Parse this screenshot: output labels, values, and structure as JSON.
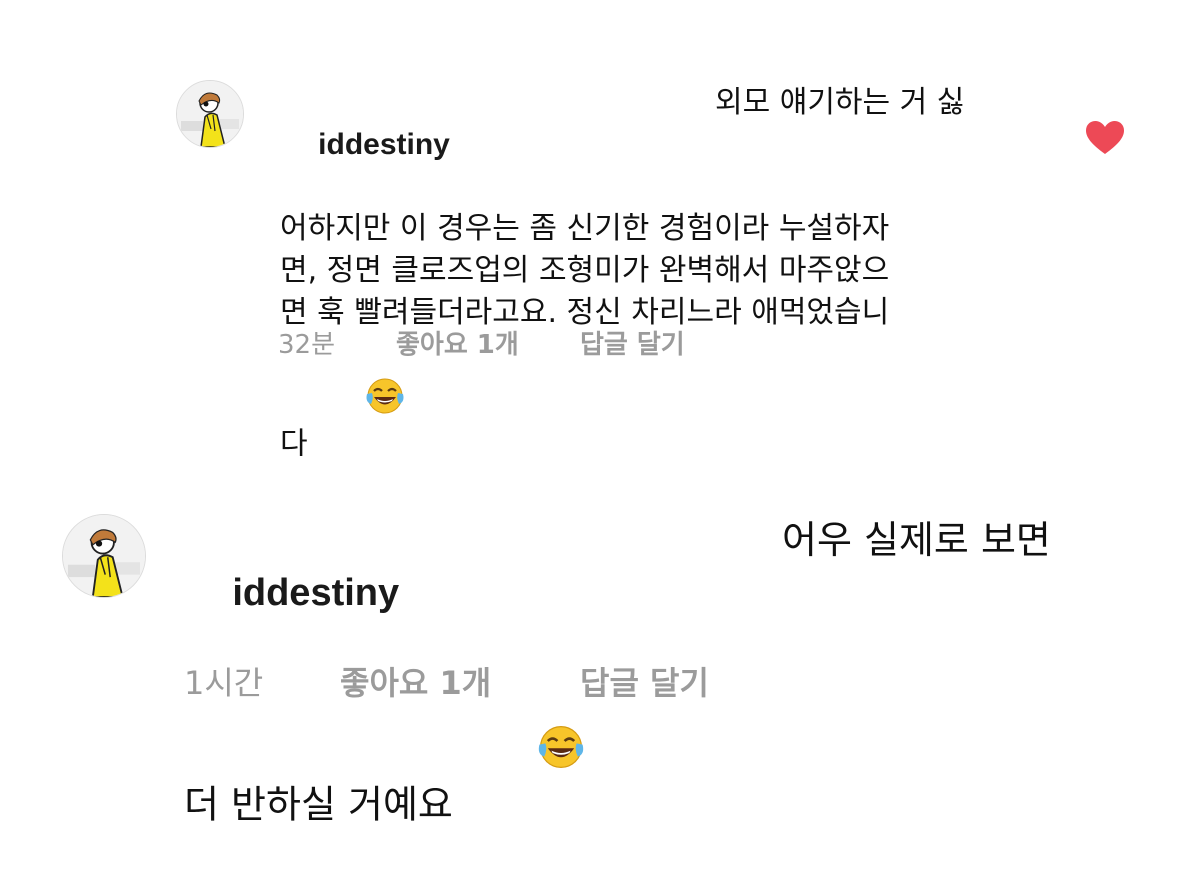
{
  "comments": [
    {
      "username": "iddestiny",
      "text_line1_tail": "외모 얘기하는 거 싫",
      "text_rest": "어하지만 이 경우는 좀 신기한 경험이라 누설하자\n면, 정면 클로즈업의 조형미가 완벽해서 마주앉으\n면 훅 빨려들더라고요. 정신 차리느라 애먹었습니\n다",
      "emoji": "tears-of-joy-emoji",
      "time": "32분",
      "likes": "좋아요 1개",
      "reply": "답글 달기",
      "liked": true
    },
    {
      "username": "iddestiny",
      "text_line1_tail": "어우 실제로 보면",
      "text_rest": "더 반하실 거예요",
      "emoji": "tears-of-joy-emoji",
      "time": "1시간",
      "likes": "좋아요 1개",
      "reply": "답글 달기",
      "liked": false
    }
  ],
  "colors": {
    "text": "#111111",
    "meta": "#9b9b9b",
    "heart": "#ed4956"
  }
}
